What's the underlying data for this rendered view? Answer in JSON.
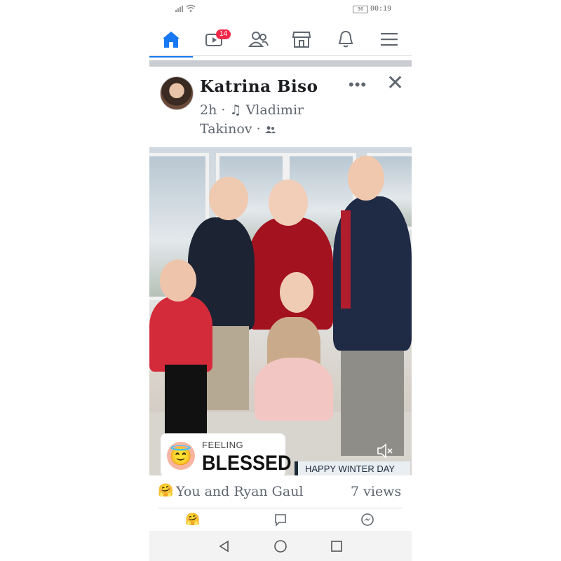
{
  "status_bar": {
    "time": "00:19",
    "battery": "36"
  },
  "nav": {
    "items": [
      {
        "name": "home-icon",
        "active": true
      },
      {
        "name": "video-icon",
        "badge": "14"
      },
      {
        "name": "friends-icon"
      },
      {
        "name": "marketplace-icon"
      },
      {
        "name": "bell-icon"
      },
      {
        "name": "menu-icon"
      }
    ],
    "video_badge": "14"
  },
  "post": {
    "author": "Katrina Biso",
    "time": "2h",
    "separator": "·",
    "music_artist": "Vladimir Takinov",
    "audience_icon": "friends-audience-icon",
    "more": "•••",
    "close": "✕"
  },
  "feeling": {
    "label": "FEELING",
    "value": "BLESSED",
    "emoji": "😇"
  },
  "photo_tag": "HAPPY WINTER DAY",
  "reactions": {
    "emoji": "🤗",
    "names": "You and Ryan Gaul",
    "views": "7 views"
  },
  "actions": [
    {
      "name": "react-button",
      "icon": "care-emoji"
    },
    {
      "name": "comment-button",
      "icon": "comment-icon"
    },
    {
      "name": "messenger-button",
      "icon": "messenger-icon"
    }
  ],
  "colors": {
    "accent": "#1877f2",
    "badge": "#f02849",
    "text": "#1c1e21",
    "muted": "#606770"
  }
}
